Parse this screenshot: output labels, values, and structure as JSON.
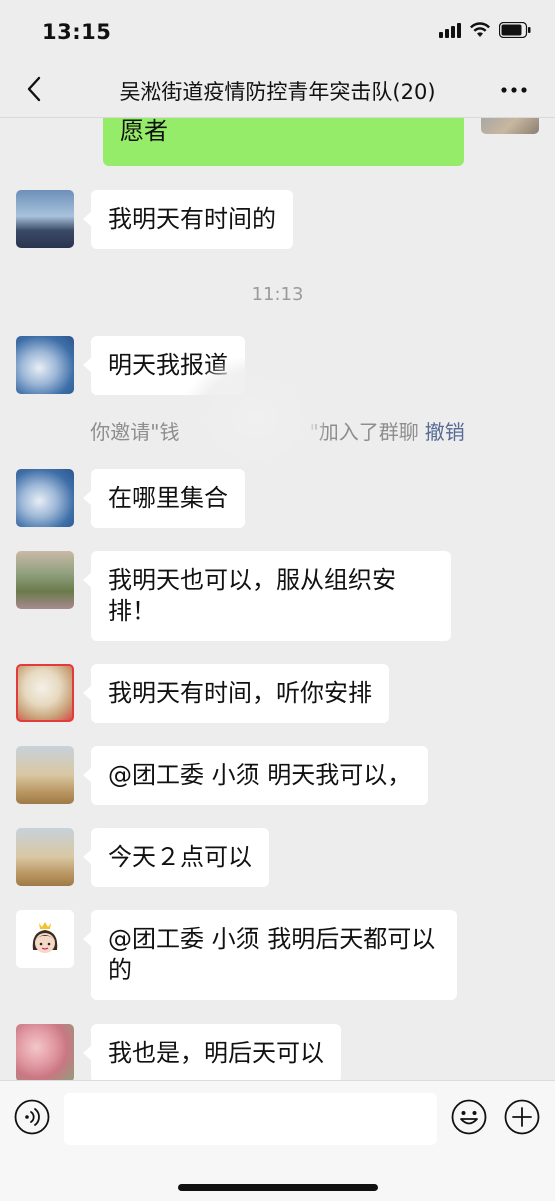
{
  "status_bar": {
    "time": "13:15"
  },
  "nav": {
    "title": "吴淞街道疫情防控青年突击队(20)"
  },
  "chat": {
    "top_own_message": "愿者",
    "timestamp": "11:13",
    "messages": [
      {
        "text": "我明天有时间的"
      },
      {
        "text": "明天我报道"
      },
      {
        "text": "在哪里集合"
      },
      {
        "text": "我明天也可以，服从组织安排！"
      },
      {
        "text": "我明天有时间，听你安排"
      },
      {
        "text": "@团工委 小须 明天我可以，"
      },
      {
        "text": "今天２点可以"
      },
      {
        "text": "@团工委 小须 我明后天都可以的"
      },
      {
        "text": "我也是，明后天可以"
      }
    ],
    "system_note": {
      "prefix": "你邀请\"钱",
      "suffix": "\"加入了群聊",
      "revoke": "撤销"
    }
  },
  "input": {
    "placeholder": ""
  },
  "colors": {
    "background": "#ededed",
    "own_bubble": "#95ec69",
    "link": "#576b95"
  }
}
